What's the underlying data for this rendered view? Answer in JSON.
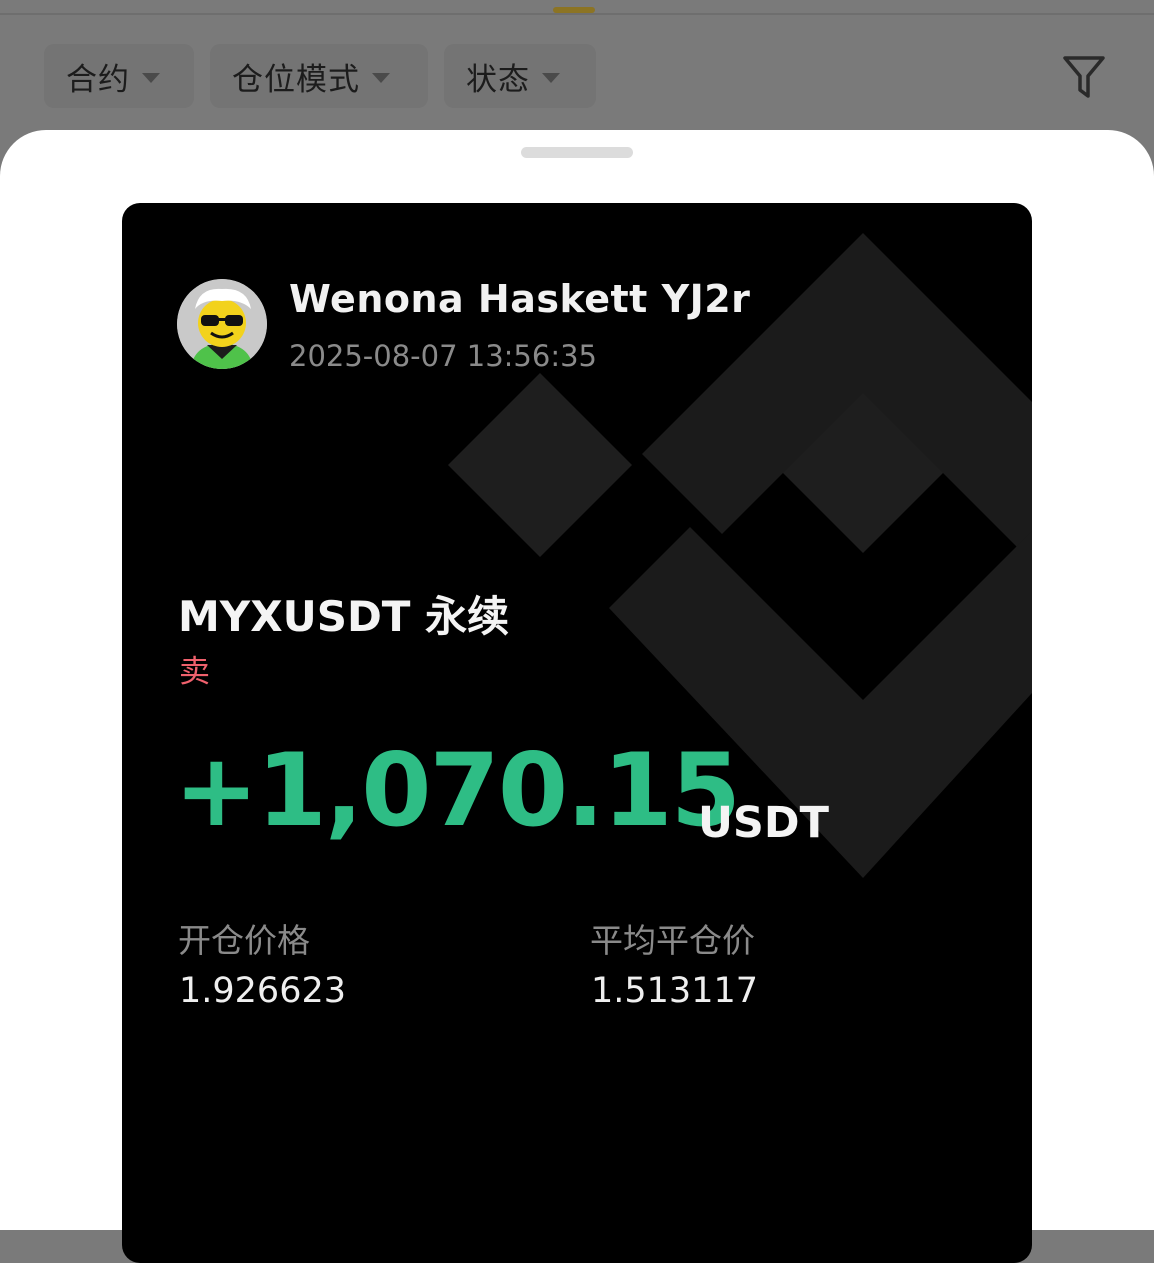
{
  "colors": {
    "overlay_background": "#7a7a7a",
    "sheet_background": "#ffffff",
    "card_background": "#000000",
    "profit_green": "#2ebd85",
    "sell_red": "#f0616d",
    "muted_text": "#8a8a8a"
  },
  "filter_bar": {
    "chips": [
      {
        "label": "合约",
        "icon": "chevron-down-icon"
      },
      {
        "label": "仓位模式",
        "icon": "chevron-down-icon"
      },
      {
        "label": "状态",
        "icon": "chevron-down-icon"
      }
    ],
    "filter_icon": "funnel-filter-icon"
  },
  "share_card": {
    "username": "Wenona Haskett YJ2r",
    "timestamp": "2025-08-07 13:56:35",
    "contract": "MYXUSDT 永续",
    "side": "卖",
    "pnl_value": "+1,070.15",
    "pnl_unit": "USDT",
    "entry_price_label": "开仓价格",
    "entry_price_value": "1.926623",
    "close_price_label": "平均平仓价",
    "close_price_value": "1.513117",
    "watermark": "binance-logo-watermark",
    "avatar": "user-avatar-cartoon"
  }
}
